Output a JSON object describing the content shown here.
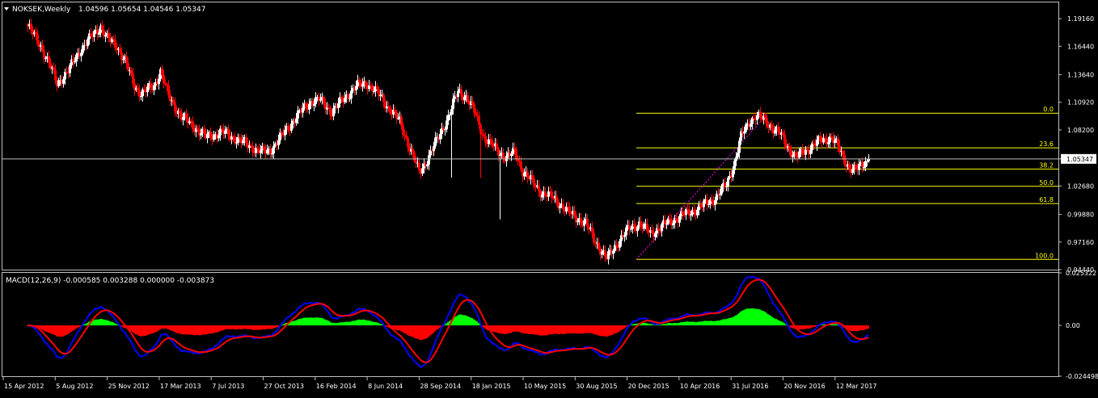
{
  "chart_data": [
    {
      "type": "candlestick",
      "symbol_header": "NOKSEK,Weekly",
      "ohlc_readout": "1.04596 1.05654 1.04546 1.05347",
      "last_price_label": "1.05347",
      "last_price": 1.05347,
      "ylim": [
        0.9444,
        1.2076
      ],
      "price_ticks": [
        "1.19160",
        "1.16440",
        "1.13640",
        "1.10920",
        "1.08200",
        "1.05347",
        "1.02680",
        "0.99880",
        "0.97160",
        "0.94440"
      ],
      "price_tick_values": [
        1.1916,
        1.1644,
        1.1364,
        1.1092,
        1.082,
        1.05347,
        1.0268,
        0.9988,
        0.9716,
        0.9444
      ],
      "time_ticks": [
        "15 Apr 2012",
        "5 Aug 2012",
        "25 Nov 2012",
        "17 Mar 2013",
        "7 Jul 2013",
        "27 Oct 2013",
        "16 Feb 2014",
        "8 Jun 2014",
        "28 Sep 2014",
        "18 Jan 2015",
        "10 May 2015",
        "30 Aug 2015",
        "20 Dec 2015",
        "10 Apr 2016",
        "31 Jul 2016",
        "20 Nov 2016",
        "12 Mar 2017"
      ],
      "bullish_color": "#FFFFFF",
      "bearish_color": "#FF0000",
      "price_path": [
        [
          0,
          1.184
        ],
        [
          8,
          1.165
        ],
        [
          15,
          1.14
        ],
        [
          18,
          1.128
        ],
        [
          25,
          1.14
        ],
        [
          32,
          1.16
        ],
        [
          40,
          1.175
        ],
        [
          45,
          1.184
        ],
        [
          49,
          1.172
        ],
        [
          55,
          1.165
        ],
        [
          60,
          1.15
        ],
        [
          66,
          1.125
        ],
        [
          70,
          1.118
        ],
        [
          78,
          1.125
        ],
        [
          82,
          1.14
        ],
        [
          87,
          1.115
        ],
        [
          95,
          1.095
        ],
        [
          103,
          1.085
        ],
        [
          110,
          1.075
        ],
        [
          120,
          1.08
        ],
        [
          127,
          1.075
        ],
        [
          135,
          1.068
        ],
        [
          145,
          1.06
        ],
        [
          150,
          1.062
        ],
        [
          158,
          1.078
        ],
        [
          166,
          1.095
        ],
        [
          175,
          1.11
        ],
        [
          180,
          1.112
        ],
        [
          188,
          1.1
        ],
        [
          195,
          1.112
        ],
        [
          203,
          1.125
        ],
        [
          210,
          1.128
        ],
        [
          218,
          1.115
        ],
        [
          225,
          1.1
        ],
        [
          230,
          1.09
        ],
        [
          236,
          1.065
        ],
        [
          242,
          1.04
        ],
        [
          246,
          1.05
        ],
        [
          254,
          1.075
        ],
        [
          260,
          1.095
        ],
        [
          266,
          1.12
        ],
        [
          271,
          1.115
        ],
        [
          276,
          1.1
        ],
        [
          282,
          1.075
        ],
        [
          290,
          1.062
        ],
        [
          296,
          1.055
        ],
        [
          301,
          1.06
        ],
        [
          306,
          1.042
        ],
        [
          312,
          1.03
        ],
        [
          318,
          1.02
        ],
        [
          325,
          1.015
        ],
        [
          330,
          1.008
        ],
        [
          335,
          1.0
        ],
        [
          340,
          0.995
        ],
        [
          345,
          0.99
        ],
        [
          350,
          0.975
        ],
        [
          355,
          0.962
        ],
        [
          358,
          0.955
        ],
        [
          365,
          0.972
        ],
        [
          372,
          0.985
        ],
        [
          378,
          0.99
        ],
        [
          385,
          0.98
        ],
        [
          395,
          0.99
        ],
        [
          405,
          0.998
        ],
        [
          415,
          1.005
        ],
        [
          425,
          1.015
        ],
        [
          432,
          1.028
        ],
        [
          437,
          1.05
        ],
        [
          441,
          1.075
        ],
        [
          446,
          1.09
        ],
        [
          450,
          1.096
        ],
        [
          455,
          1.092
        ],
        [
          460,
          1.085
        ],
        [
          465,
          1.078
        ],
        [
          470,
          1.065
        ],
        [
          475,
          1.055
        ],
        [
          480,
          1.06
        ],
        [
          486,
          1.068
        ],
        [
          492,
          1.072
        ],
        [
          497,
          1.075
        ],
        [
          500,
          1.068
        ],
        [
          504,
          1.055
        ],
        [
          508,
          1.045
        ],
        [
          512,
          1.042
        ],
        [
          516,
          1.048
        ],
        [
          520,
          1.0535
        ]
      ],
      "fibonacci": {
        "levels": [
          {
            "label": "0.0",
            "price": 1.0985
          },
          {
            "label": "23.6",
            "price": 1.0644
          },
          {
            "label": "38.2",
            "price": 1.0435
          },
          {
            "label": "50.0",
            "price": 1.0265
          },
          {
            "label": "61.8",
            "price": 1.0095
          },
          {
            "label": "100.0",
            "price": 0.9545
          }
        ],
        "line_color": "#FFFF00"
      }
    },
    {
      "type": "histogram_line",
      "indicator_header": "MACD(12,26,9) -0.000585 0.003288 0.000000 -0.003873",
      "ylim": [
        -0.0245,
        0.02533
      ],
      "y_ticks": [
        "0.025322",
        "0.00",
        "-0.024498"
      ],
      "y_tick_values": [
        0.025322,
        0.0,
        -0.024498
      ],
      "positive_color": "#00FF00",
      "negative_color": "#FF0000",
      "macd_line_color": "#0000FF",
      "signal_line_color": "#FF0000"
    }
  ]
}
